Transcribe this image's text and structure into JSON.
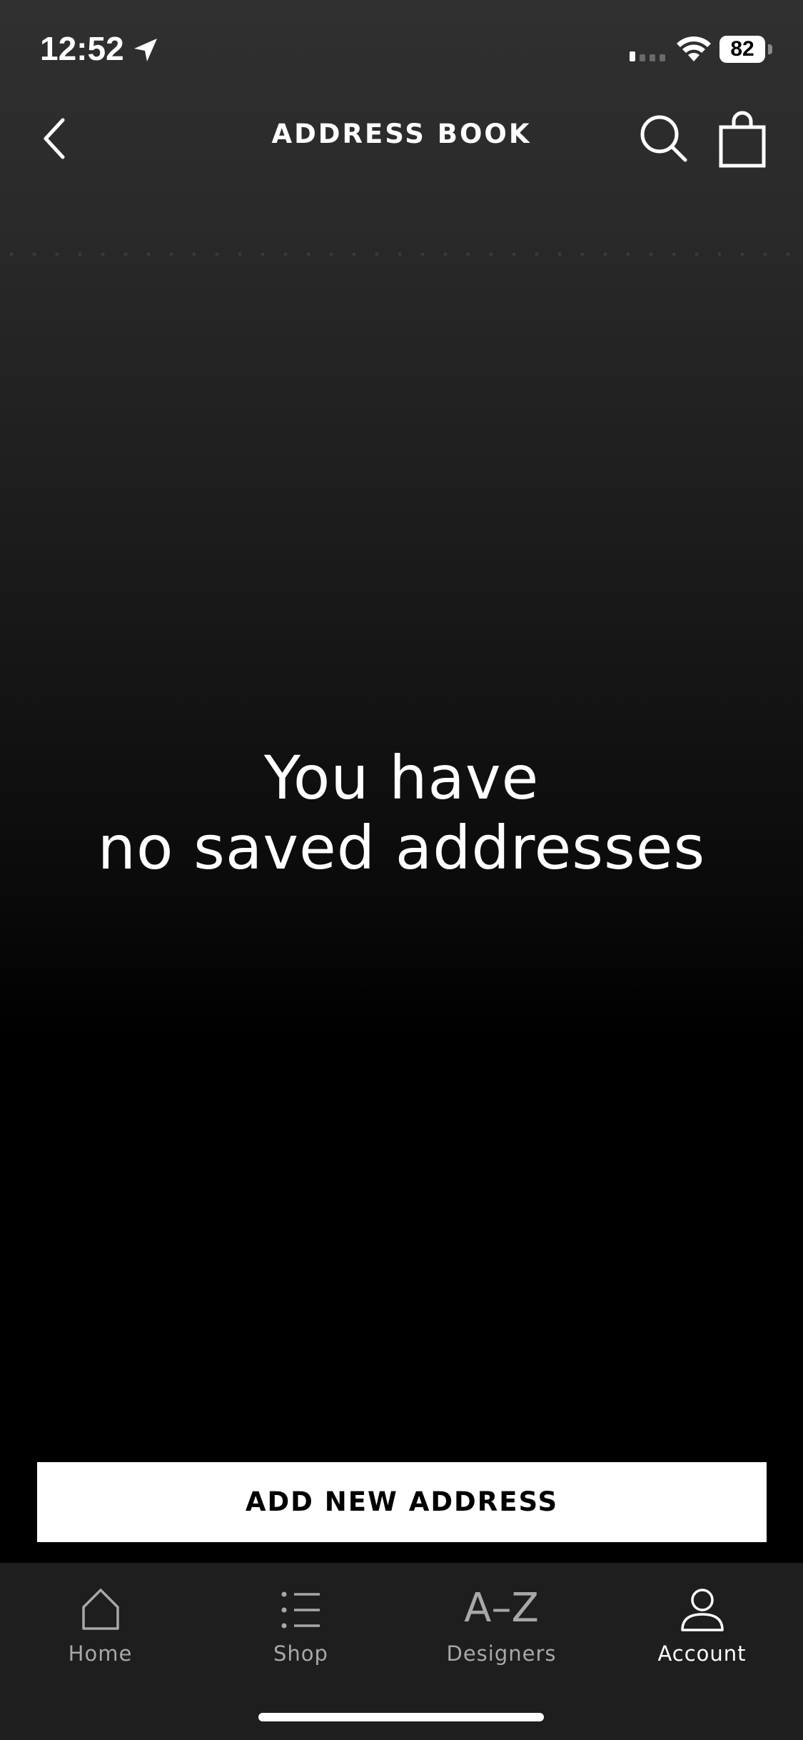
{
  "status_bar": {
    "time": "12:52",
    "battery": "82",
    "icons": [
      "location-arrow-icon",
      "cellular-signal-icon",
      "wifi-icon",
      "battery-icon"
    ]
  },
  "header": {
    "title": "ADDRESS BOOK",
    "icons": [
      "chevron-left-icon",
      "search-icon",
      "shopping-bag-icon"
    ]
  },
  "empty_state": {
    "line1": "You have",
    "line2": "no saved addresses"
  },
  "actions": {
    "add_label": "ADD NEW ADDRESS"
  },
  "tab_bar": {
    "active": "account",
    "tabs": [
      {
        "id": "home",
        "label": "Home",
        "icon": "home-icon"
      },
      {
        "id": "shop",
        "label": "Shop",
        "icon": "list-icon"
      },
      {
        "id": "designers",
        "label": "Designers",
        "icon": "a-z-icon",
        "glyph": "A–Z"
      },
      {
        "id": "account",
        "label": "Account",
        "icon": "person-icon"
      }
    ]
  },
  "colors": {
    "background_top": "#303030",
    "background_bottom": "#000000",
    "text": "#ffffff",
    "button_bg": "#ffffff",
    "button_text": "#000000",
    "tab_bar_bg": "#1e1e1e",
    "tab_inactive": "#a8a8a8",
    "tab_active": "#ffffff"
  }
}
